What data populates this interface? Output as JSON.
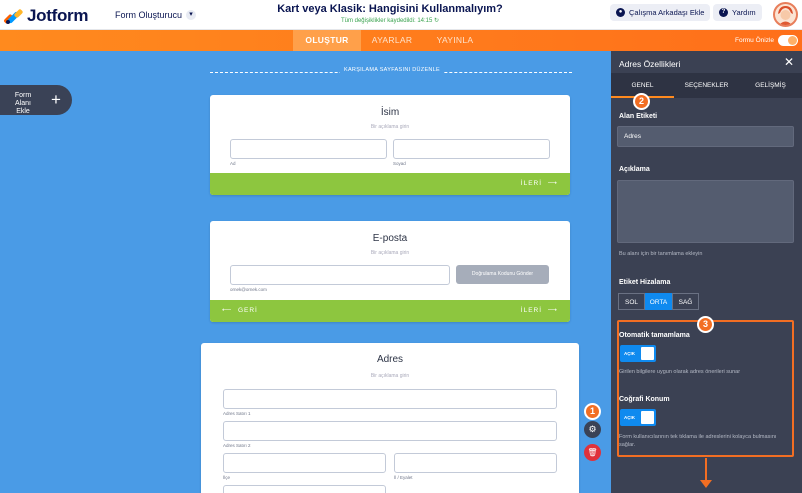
{
  "app": {
    "logo_text": "Jotform",
    "builder_label": "Form Oluşturucu",
    "title": "Kart veya Klasik: Hangisini Kullanmalıyım?",
    "saved_status": "Tüm değişiklikler kaydedildi: 14:15",
    "collab_label": "Çalışma Arkadaşı Ekle",
    "help_label": "Yardım"
  },
  "nav": {
    "tabs": [
      "OLUŞTUR",
      "AYARLAR",
      "YAYINLA"
    ],
    "active": "OLUŞTUR",
    "preview_label": "Formu Önizle"
  },
  "canvas": {
    "add_field_label": "Form Alanı Ekle",
    "welcome_label": "KARŞILAMA SAYFASINI DÜZENLE"
  },
  "cards": {
    "name": {
      "title": "İsim",
      "description": "Bir açıklama girin",
      "first_label": "Ad",
      "last_label": "Soyad",
      "next_label": "İLERİ"
    },
    "email": {
      "title": "E-posta",
      "description": "Bir açıklama girin",
      "verify_label": "Doğrulama Kodunu Gönder",
      "example": "ornek@ornek.com",
      "back_label": "GERİ",
      "next_label": "İLERİ"
    },
    "address": {
      "title": "Adres",
      "description": "Bir açıklama girin",
      "line1_label": "Adres Satırı 1",
      "line2_label": "Adres Satırı 2",
      "district_label": "İlçe",
      "state_label": "İl / Eyalet"
    }
  },
  "panel": {
    "title": "Adres Özellikleri",
    "tabs": [
      "GENEL",
      "SEÇENEKLER",
      "GELİŞMİŞ"
    ],
    "field_label_heading": "Alan Etiketi",
    "field_label_value": "Adres",
    "description_heading": "Açıklama",
    "description_hint": "Bu alanı için bir tanımlama ekleyin",
    "label_align_heading": "Etiket Hizalama",
    "align_options": [
      "SOL",
      "ORTA",
      "SAĞ"
    ],
    "align_selected": "ORTA",
    "autocomplete_heading": "Otomatik tamamlama",
    "autocomplete_state": "AÇIK",
    "autocomplete_hint": "Girilen bilgilere uygun olarak adres önerileri sunar",
    "geo_heading": "Coğrafi Konum",
    "geo_state": "AÇIK",
    "geo_hint": "Form kullanıcılarının tek tıklama ile adreslerini kolayca bulmasını sağlar."
  },
  "callouts": [
    "1",
    "2",
    "3"
  ],
  "colors": {
    "canvas": "#4a9be6",
    "nav_orange": "#ff7b1c",
    "green_bar": "#8dc63f",
    "panel": "#3b4153",
    "accent_blue": "#0f8aef",
    "callout": "#f26e23"
  }
}
